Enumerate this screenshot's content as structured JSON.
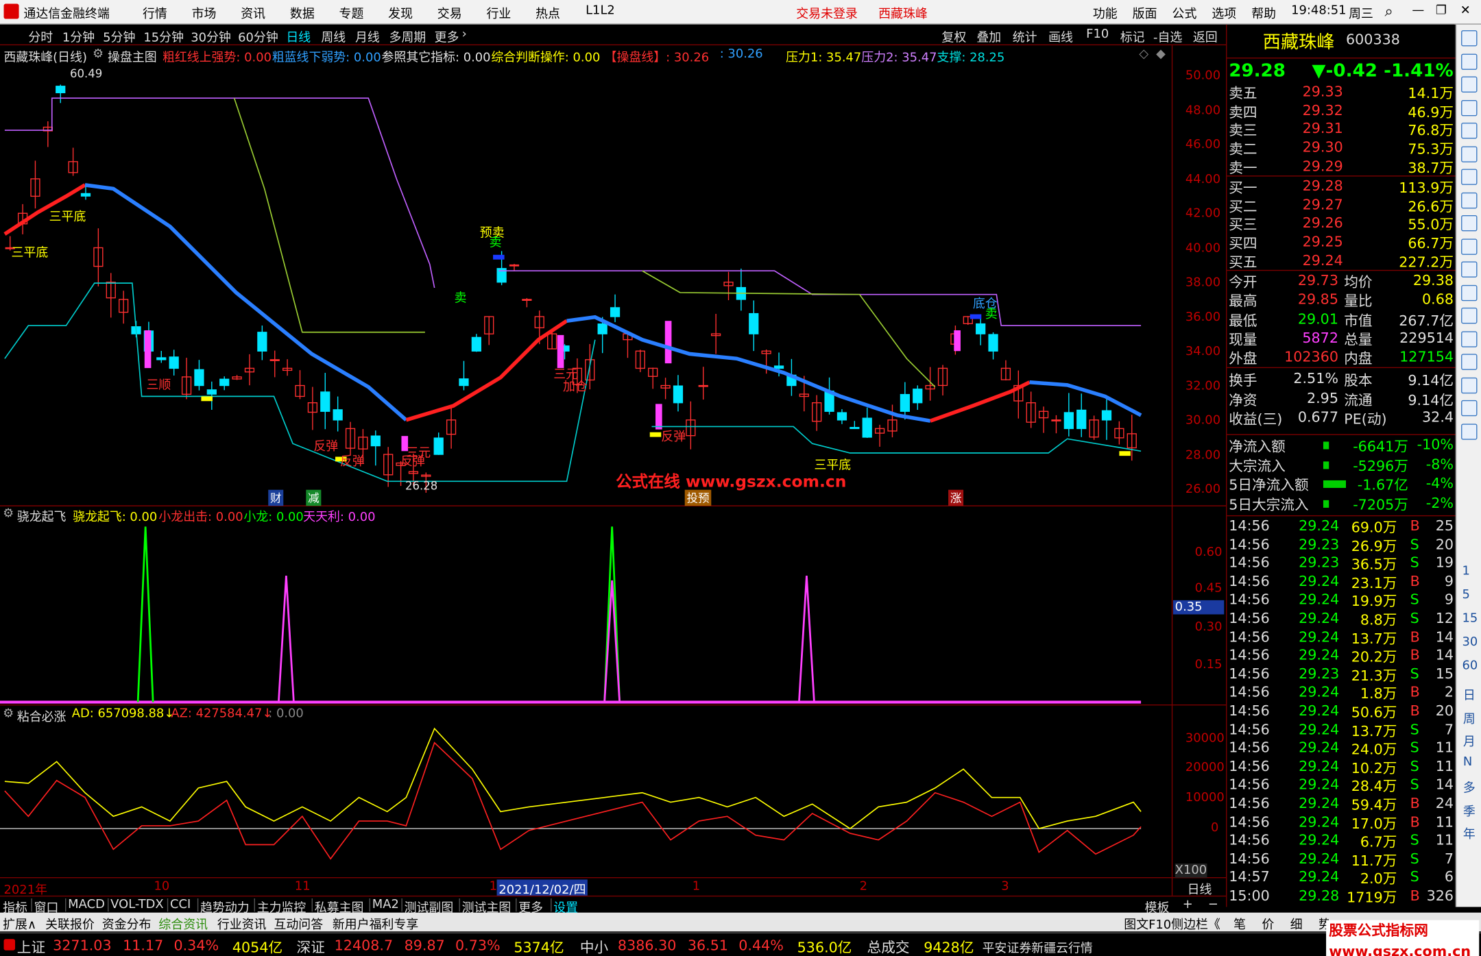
{
  "app": {
    "title": "通达信金融终端",
    "menu": [
      "行情",
      "市场",
      "资讯",
      "数据",
      "专题",
      "发现",
      "交易",
      "行业",
      "热点",
      "L1L2"
    ],
    "status": [
      "交易未登录",
      "西藏珠峰"
    ],
    "right_menu": [
      "功能",
      "版面",
      "公式",
      "选项",
      "帮助"
    ],
    "clock": "19:48:51",
    "weekday": "周三"
  },
  "periods": {
    "items": [
      "分时",
      "1分钟",
      "5分钟",
      "15分钟",
      "30分钟",
      "60分钟",
      "日线",
      "周线",
      "月线",
      "多周期",
      "更多"
    ],
    "active": "日线",
    "tools": [
      "复权",
      "叠加",
      "统计",
      "画线",
      "F10",
      "标记",
      "-自选",
      "返回"
    ]
  },
  "main_chart": {
    "stock_label": "西藏珠峰(日线)",
    "formula": "操盘主图",
    "legend": [
      {
        "text": "粗红线上强势: 0.00",
        "color": "#ff3030"
      },
      {
        "text": "粗蓝线下弱势: 0.00",
        "color": "#30a0ff"
      },
      {
        "text": "参照其它指标: 0.00",
        "color": "#e0e0e0"
      },
      {
        "text": "综合判断操作: 0.00",
        "color": "#ffff00"
      },
      {
        "text": "【操盘线】: 30.26",
        "color": "#ff3030"
      },
      {
        "text": ": 30.26",
        "color": "#30a0ff"
      },
      {
        "text": "压力1: 35.47",
        "color": "#ffff00"
      },
      {
        "text": "压力2: 35.47",
        "color": "#d080ff"
      },
      {
        "text": "支撑: 28.25",
        "color": "#00e0e0"
      }
    ],
    "yaxis": [
      "50.00",
      "48.00",
      "46.00",
      "44.00",
      "42.00",
      "40.00",
      "38.00",
      "36.00",
      "34.00",
      "32.00",
      "30.00",
      "28.00",
      "26.00"
    ],
    "labels": [
      {
        "text": "三平底",
        "c": "#ffff00"
      },
      {
        "text": "三平底",
        "c": "#ffff00"
      },
      {
        "text": "60.49",
        "c": "#e0e0e0"
      },
      {
        "text": "预卖",
        "c": "#ffff00"
      },
      {
        "text": "卖",
        "c": "#00ff00"
      },
      {
        "text": "卖",
        "c": "#00ff00"
      },
      {
        "text": "三顺",
        "c": "#ff3030"
      },
      {
        "text": "反弹",
        "c": "#ff3030"
      },
      {
        "text": "反弹",
        "c": "#ff3030"
      },
      {
        "text": "三元",
        "c": "#ff3030"
      },
      {
        "text": "反弹",
        "c": "#ff3030"
      },
      {
        "text": "三元",
        "c": "#ff3030"
      },
      {
        "text": "加仓",
        "c": "#ff3030"
      },
      {
        "text": "反弹",
        "c": "#ff3030"
      },
      {
        "text": "三平底",
        "c": "#ffff00"
      },
      {
        "text": "底仓",
        "c": "#30a0ff"
      },
      {
        "text": "卖",
        "c": "#00ff00"
      },
      {
        "text": "26.28",
        "c": "#e0e0e0"
      }
    ],
    "watermark": "公式在线  www.gszx.com.cn",
    "events": [
      "财",
      "减",
      "投预",
      "涨"
    ]
  },
  "sub1": {
    "name": "骁龙起飞",
    "legend": [
      {
        "text": "骁龙起飞: 0.00",
        "c": "#ffff00"
      },
      {
        "text": "小龙出击: 0.00",
        "c": "#ff3030"
      },
      {
        "text": "小龙: 0.00",
        "c": "#00ff00"
      },
      {
        "text": "天天利: 0.00",
        "c": "#ff40ff"
      }
    ],
    "yaxis": [
      "0.60",
      "0.45",
      "0.30",
      "0.15"
    ],
    "cursor": "0.35"
  },
  "sub2": {
    "name": "粘合必涨",
    "legend": [
      {
        "text": "AD: 657098.88↓",
        "c": "#ffff00"
      },
      {
        "text": "AZ: 427584.47↓",
        "c": "#ff3030"
      },
      {
        "text": ": 0.00",
        "c": "#888888"
      }
    ],
    "yaxis": [
      "30000",
      "20000",
      "10000",
      "0"
    ],
    "unit": "X100"
  },
  "time_axis": {
    "labels": [
      "2021年",
      "10",
      "11",
      "1",
      "2021/12/02/四",
      "1",
      "2",
      "3"
    ],
    "period": "日线"
  },
  "quote": {
    "name": "西藏珠峰",
    "code": "600338",
    "price": "29.28",
    "change": "▼-0.42",
    "pct": "-1.41%",
    "asks": [
      {
        "n": "卖五",
        "p": "29.33",
        "v": "14.1万"
      },
      {
        "n": "卖四",
        "p": "29.32",
        "v": "46.9万"
      },
      {
        "n": "卖三",
        "p": "29.31",
        "v": "76.8万"
      },
      {
        "n": "卖二",
        "p": "29.30",
        "v": "75.3万"
      },
      {
        "n": "卖一",
        "p": "29.29",
        "v": "38.7万"
      }
    ],
    "bids": [
      {
        "n": "买一",
        "p": "29.28",
        "v": "113.9万"
      },
      {
        "n": "买二",
        "p": "29.27",
        "v": "26.6万"
      },
      {
        "n": "买三",
        "p": "29.26",
        "v": "55.0万"
      },
      {
        "n": "买四",
        "p": "29.25",
        "v": "66.7万"
      },
      {
        "n": "买五",
        "p": "29.24",
        "v": "227.2万"
      }
    ],
    "stats": [
      [
        {
          "l": "今开",
          "v": "29.73",
          "c": "#ff3030"
        },
        {
          "l": "均价",
          "v": "29.38",
          "c": "#ffff00"
        }
      ],
      [
        {
          "l": "最高",
          "v": "29.85",
          "c": "#ff3030"
        },
        {
          "l": "量比",
          "v": "0.68",
          "c": "#ffff00"
        }
      ],
      [
        {
          "l": "最低",
          "v": "29.01",
          "c": "#00ff00"
        },
        {
          "l": "市值",
          "v": "267.7亿",
          "c": "#e0e0e0"
        }
      ],
      [
        {
          "l": "现量",
          "v": "5872",
          "c": "#ff40ff"
        },
        {
          "l": "总量",
          "v": "229514",
          "c": "#e0e0e0"
        }
      ],
      [
        {
          "l": "外盘",
          "v": "102360",
          "c": "#ff3030"
        },
        {
          "l": "内盘",
          "v": "127154",
          "c": "#00ff00"
        }
      ],
      [
        {
          "l": "换手",
          "v": "2.51%",
          "c": "#e0e0e0"
        },
        {
          "l": "股本",
          "v": "9.14亿",
          "c": "#e0e0e0"
        }
      ],
      [
        {
          "l": "净资",
          "v": "2.95",
          "c": "#e0e0e0"
        },
        {
          "l": "流通",
          "v": "9.14亿",
          "c": "#e0e0e0"
        }
      ],
      [
        {
          "l": "收益(三)",
          "v": "0.677",
          "c": "#e0e0e0"
        },
        {
          "l": "PE(动)",
          "v": "32.4",
          "c": "#e0e0e0"
        }
      ]
    ],
    "flows": [
      {
        "l": "净流入额",
        "v": "-6641万",
        "p": "-10%"
      },
      {
        "l": "大宗流入",
        "v": "-5296万",
        "p": "-8%"
      },
      {
        "l": "5日净流入额",
        "v": "-1.67亿",
        "p": "-4%"
      },
      {
        "l": "5日大宗流入",
        "v": "-7205万",
        "p": "-2%"
      }
    ],
    "ticks": [
      [
        "14:56",
        "29.24",
        "69.0万",
        "B",
        "25"
      ],
      [
        "14:56",
        "29.23",
        "26.9万",
        "S",
        "20"
      ],
      [
        "14:56",
        "29.23",
        "36.5万",
        "S",
        "19"
      ],
      [
        "14:56",
        "29.24",
        "23.1万",
        "B",
        "9"
      ],
      [
        "14:56",
        "29.24",
        "19.9万",
        "S",
        "9"
      ],
      [
        "14:56",
        "29.24",
        "8.8万",
        "S",
        "12"
      ],
      [
        "14:56",
        "29.24",
        "13.7万",
        "B",
        "14"
      ],
      [
        "14:56",
        "29.24",
        "20.2万",
        "B",
        "14"
      ],
      [
        "14:56",
        "29.23",
        "21.3万",
        "S",
        "15"
      ],
      [
        "14:56",
        "29.24",
        "1.8万",
        "B",
        "2"
      ],
      [
        "14:56",
        "29.24",
        "50.6万",
        "B",
        "20"
      ],
      [
        "14:56",
        "29.24",
        "13.7万",
        "S",
        "7"
      ],
      [
        "14:56",
        "29.24",
        "24.0万",
        "S",
        "11"
      ],
      [
        "14:56",
        "29.24",
        "10.2万",
        "S",
        "11"
      ],
      [
        "14:56",
        "29.24",
        "28.4万",
        "S",
        "14"
      ],
      [
        "14:56",
        "29.24",
        "59.4万",
        "B",
        "24"
      ],
      [
        "14:56",
        "29.24",
        "17.0万",
        "B",
        "11"
      ],
      [
        "14:56",
        "29.24",
        "6.7万",
        "S",
        "11"
      ],
      [
        "14:56",
        "29.24",
        "11.7万",
        "S",
        "7"
      ],
      [
        "14:57",
        "29.24",
        "2.0万",
        "S",
        "6"
      ],
      [
        "15:00",
        "29.28",
        "1719万",
        "B",
        "326"
      ]
    ]
  },
  "sidebar_text": [
    "日",
    "周",
    "月",
    "N",
    "多",
    "季",
    "年"
  ],
  "bottom_tabs": [
    "指标",
    "窗口",
    "MACD",
    "VOL-TDX",
    "CCI",
    "趋势动力",
    "主力监控",
    "私募主图",
    "MA2",
    "测试副图",
    "测试主图",
    "更多",
    "设置"
  ],
  "bottom_tabs_active": "设置",
  "template": "模板",
  "bottom2": [
    "扩展∧",
    "关联报价",
    "资金分布",
    "综合资讯",
    "行业资讯",
    "互动问答",
    "新用户福利专享"
  ],
  "bottom2_right": [
    "图文F10",
    "侧边栏《",
    "笔",
    "价",
    "细",
    "势"
  ],
  "index_bar": [
    {
      "name": "上证",
      "v": "3271.03",
      "c": "11.17",
      "p": "0.34%",
      "a": "4054亿"
    },
    {
      "name": "深证",
      "v": "12408.7",
      "c": "89.87",
      "p": "0.73%",
      "a": "5374亿"
    },
    {
      "name": "中小",
      "v": "8386.30",
      "c": "36.51",
      "p": "0.44%",
      "a": "536.0亿"
    }
  ],
  "total_label": "总成交",
  "total": "9428亿",
  "broker": "平安证券新疆云行情",
  "site": "股票公式指标网 www.gszx.com.cn"
}
